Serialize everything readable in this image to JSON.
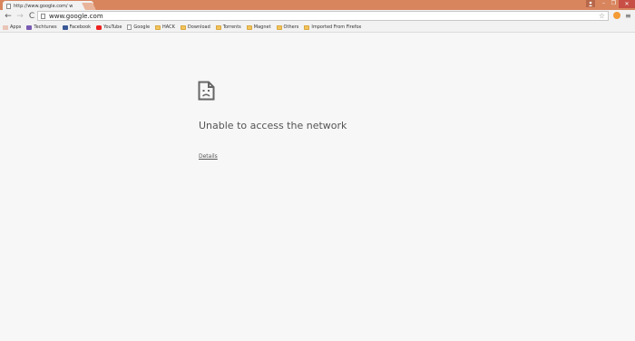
{
  "tab": {
    "title": "http://www.google.com/ w",
    "close": "×"
  },
  "window": {
    "minimize": "–",
    "maximize": "❐",
    "close": "✕"
  },
  "toolbar": {
    "back": "←",
    "forward": "→",
    "reload": "C",
    "url": "www.google.com",
    "star": "☆",
    "menu": "≡"
  },
  "bookmarks": [
    {
      "label": "Apps",
      "icon": "apps-icon"
    },
    {
      "label": "Techtunes",
      "icon": "techtunes-icon"
    },
    {
      "label": "Facebook",
      "icon": "facebook-icon"
    },
    {
      "label": "YouTube",
      "icon": "youtube-icon"
    },
    {
      "label": "Google",
      "icon": "page-icon"
    },
    {
      "label": "HACK",
      "icon": "folder-icon"
    },
    {
      "label": "Download",
      "icon": "folder-icon"
    },
    {
      "label": "Torrents",
      "icon": "folder-icon"
    },
    {
      "label": "Magnet",
      "icon": "folder-icon"
    },
    {
      "label": "Others",
      "icon": "folder-icon"
    },
    {
      "label": "Imported From Firefox",
      "icon": "folder-icon"
    }
  ],
  "error": {
    "title": "Unable to access the network",
    "details_link": "Details"
  },
  "colors": {
    "frame": "#d8855e",
    "close": "#c74f45",
    "page_bg": "#f7f7f7",
    "text": "#555555"
  }
}
